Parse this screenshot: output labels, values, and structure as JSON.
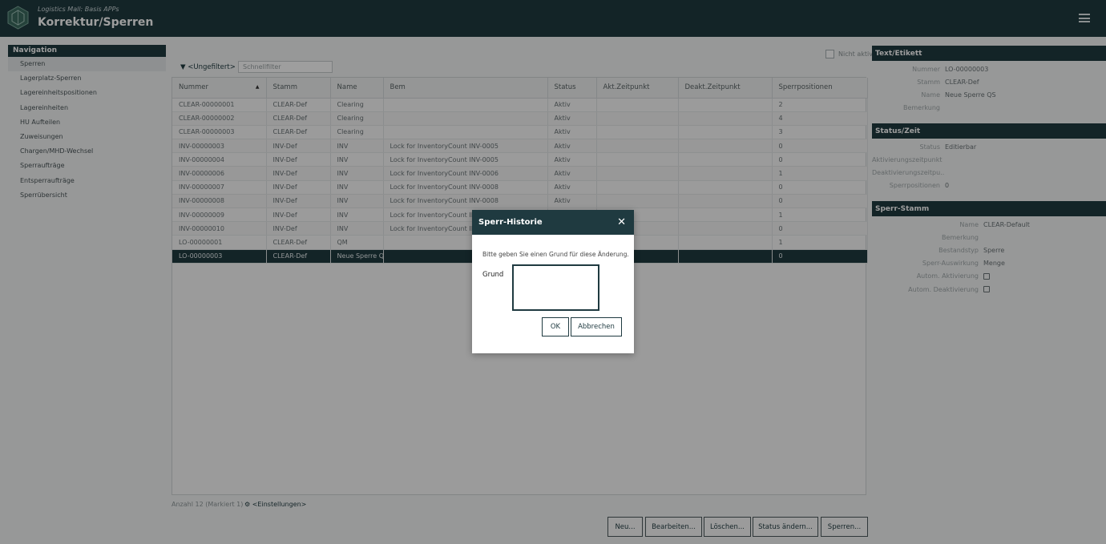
{
  "header": {
    "subtitle": "Logistics Mall: Basis APPs",
    "title": "Korrektur/Sperren"
  },
  "nav": {
    "title": "Navigation",
    "items": [
      "Sperren",
      "Lagerplatz-Sperren",
      "Lagereinheitspositionen",
      "Lagereinheiten",
      "HU Aufteilen",
      "Zuweisungen",
      "Chargen/MHD-Wechsel",
      "Sperraufträge",
      "Entsperraufträge",
      "Sperrübersicht"
    ]
  },
  "filter": {
    "label": "<Ungefiltert>",
    "quick_placeholder": "Schnellfilter",
    "inactive_label": "Nicht aktiv"
  },
  "table": {
    "columns": [
      "Nummer",
      "Stamm",
      "Name",
      "Bem",
      "Status",
      "Akt.Zeitpunkt",
      "Deakt.Zeitpunkt",
      "Sperrpositionen"
    ],
    "rows": [
      [
        "CLEAR-00000001",
        "CLEAR-Def",
        "Clearing",
        "",
        "Aktiv",
        "",
        "",
        "2"
      ],
      [
        "CLEAR-00000002",
        "CLEAR-Def",
        "Clearing",
        "",
        "Aktiv",
        "",
        "",
        "4"
      ],
      [
        "CLEAR-00000003",
        "CLEAR-Def",
        "Clearing",
        "",
        "Aktiv",
        "",
        "",
        "3"
      ],
      [
        "INV-00000003",
        "INV-Def",
        "INV",
        "Lock for InventoryCount INV-0005",
        "Aktiv",
        "",
        "",
        "0"
      ],
      [
        "INV-00000004",
        "INV-Def",
        "INV",
        "Lock for InventoryCount INV-0005",
        "Aktiv",
        "",
        "",
        "0"
      ],
      [
        "INV-00000006",
        "INV-Def",
        "INV",
        "Lock for InventoryCount INV-0006",
        "Aktiv",
        "",
        "",
        "1"
      ],
      [
        "INV-00000007",
        "INV-Def",
        "INV",
        "Lock for InventoryCount INV-0008",
        "Aktiv",
        "",
        "",
        "0"
      ],
      [
        "INV-00000008",
        "INV-Def",
        "INV",
        "Lock for InventoryCount INV-0008",
        "Aktiv",
        "",
        "",
        "0"
      ],
      [
        "INV-00000009",
        "INV-Def",
        "INV",
        "Lock for InventoryCount INV",
        "",
        "",
        "",
        "1"
      ],
      [
        "INV-00000010",
        "INV-Def",
        "INV",
        "Lock for InventoryCount INV",
        "",
        "",
        "",
        "0"
      ],
      [
        "LO-00000001",
        "CLEAR-Def",
        "QM",
        "",
        "",
        "",
        "",
        "1"
      ],
      [
        "LO-00000003",
        "CLEAR-Def",
        "Neue Sperre QS",
        "",
        "",
        "",
        "",
        "0"
      ]
    ],
    "selected_index": 11
  },
  "footer": {
    "count": "Anzahl 12 (Markiert 1)",
    "settings": "<Einstellungen>"
  },
  "buttons": {
    "new": "Neu...",
    "edit": "Bearbeiten...",
    "delete": "Löschen...",
    "status": "Status ändern...",
    "lock": "Sperren..."
  },
  "panel": {
    "text_title": "Text/Etikett",
    "text_fields": [
      {
        "k": "Nummer",
        "v": "LO-00000003"
      },
      {
        "k": "Stamm",
        "v": "CLEAR-Def"
      },
      {
        "k": "Name",
        "v": "Neue Sperre QS"
      },
      {
        "k": "Bemerkung",
        "v": ""
      }
    ],
    "status_title": "Status/Zeit",
    "status_fields": [
      {
        "k": "Status",
        "v": "Editierbar"
      },
      {
        "k": "Aktivierungszeitpunkt",
        "v": ""
      },
      {
        "k": "Deaktivierungszeitpu...",
        "v": ""
      },
      {
        "k": "Sperrpositionen",
        "v": "0"
      }
    ],
    "stamm_title": "Sperr-Stamm",
    "stamm_fields": [
      {
        "k": "Name",
        "v": "CLEAR-Default"
      },
      {
        "k": "Bemerkung",
        "v": ""
      },
      {
        "k": "Bestandstyp",
        "v": "Sperre"
      },
      {
        "k": "Sperr-Auswirkung",
        "v": "Menge"
      },
      {
        "k": "Autom. Aktivierung",
        "v": ""
      },
      {
        "k": "Autom. Deaktivierung",
        "v": ""
      }
    ]
  },
  "modal": {
    "title": "Sperr-Historie",
    "message": "Bitte geben Sie einen Grund für diese Änderung.",
    "label": "Grund",
    "ok": "OK",
    "cancel": "Abbrechen"
  }
}
